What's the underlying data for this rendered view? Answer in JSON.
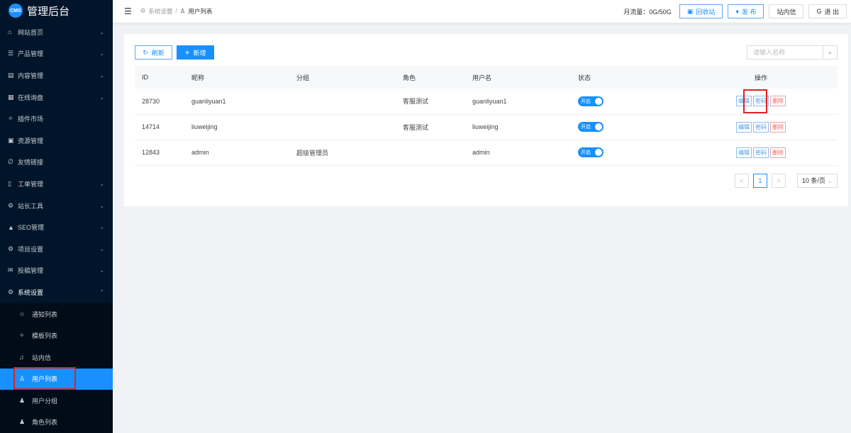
{
  "app": {
    "logo": "CMS",
    "title": "管理后台"
  },
  "sidebar": {
    "items": [
      {
        "label": "网站首页",
        "icon": "home-icon",
        "glyph": "⌂",
        "chev": true
      },
      {
        "label": "产品管理",
        "icon": "list-icon",
        "glyph": "☰",
        "chev": true
      },
      {
        "label": "内容管理",
        "icon": "content-icon",
        "glyph": "▤",
        "chev": true
      },
      {
        "label": "在线询盘",
        "icon": "table-icon",
        "glyph": "▦",
        "chev": true
      },
      {
        "label": "插件市场",
        "icon": "pin-icon",
        "glyph": "✧",
        "chev": false
      },
      {
        "label": "资源管理",
        "icon": "grid-icon",
        "glyph": "▣",
        "chev": false
      },
      {
        "label": "友情链接",
        "icon": "link-icon",
        "glyph": "∅",
        "chev": false
      },
      {
        "label": "工单管理",
        "icon": "ticket-icon",
        "glyph": "▯",
        "chev": true
      },
      {
        "label": "站长工具",
        "icon": "tools-icon",
        "glyph": "⚙",
        "chev": true
      },
      {
        "label": "SEO管理",
        "icon": "warning-icon",
        "glyph": "▲",
        "chev": true
      },
      {
        "label": "项目设置",
        "icon": "settings-icon",
        "glyph": "⚙",
        "chev": true
      },
      {
        "label": "投稿管理",
        "icon": "mail-icon",
        "glyph": "✉",
        "chev": true
      },
      {
        "label": "系统设置",
        "icon": "settings-icon",
        "glyph": "⚙",
        "chev": true
      }
    ],
    "sub": [
      {
        "label": "通知列表",
        "icon": "star-icon",
        "glyph": "☆"
      },
      {
        "label": "模板列表",
        "icon": "pin-icon",
        "glyph": "✧"
      },
      {
        "label": "站内信",
        "icon": "bell-icon",
        "glyph": "♫"
      },
      {
        "label": "用户列表",
        "icon": "user-icon",
        "glyph": "♙"
      },
      {
        "label": "用户分组",
        "icon": "users-icon",
        "glyph": "♟"
      },
      {
        "label": "角色列表",
        "icon": "person-icon",
        "glyph": "♟"
      }
    ]
  },
  "header": {
    "crumb_parent": "系统设置",
    "crumb_sep": "/",
    "crumb_current": "用户列表",
    "flow": "月流量：0G/50G",
    "recycle": "回收站",
    "publish": "发 布",
    "messages": "站内信",
    "logout": "退 出"
  },
  "toolbar": {
    "refresh": "刷新",
    "add": "新增",
    "search_placeholder": "请输入名称"
  },
  "table": {
    "headers": [
      "ID",
      "昵称",
      "分组",
      "角色",
      "用户名",
      "状态",
      "操作"
    ],
    "rows": [
      {
        "id": "28730",
        "nick": "guanliyuan1",
        "group": "",
        "role": "客服测试",
        "username": "guanliyuan1",
        "status": "开启"
      },
      {
        "id": "14714",
        "nick": "liuweijing",
        "group": "",
        "role": "客服测试",
        "username": "liuweijing",
        "status": "开启"
      },
      {
        "id": "12843",
        "nick": "admin",
        "group": "超级管理员",
        "role": "",
        "username": "admin",
        "status": "开启"
      }
    ],
    "actions": {
      "edit": "编辑",
      "password": "密码",
      "delete": "删除"
    }
  },
  "pager": {
    "prev": "<",
    "page": "1",
    "next": ">",
    "size": "10 条/页"
  }
}
